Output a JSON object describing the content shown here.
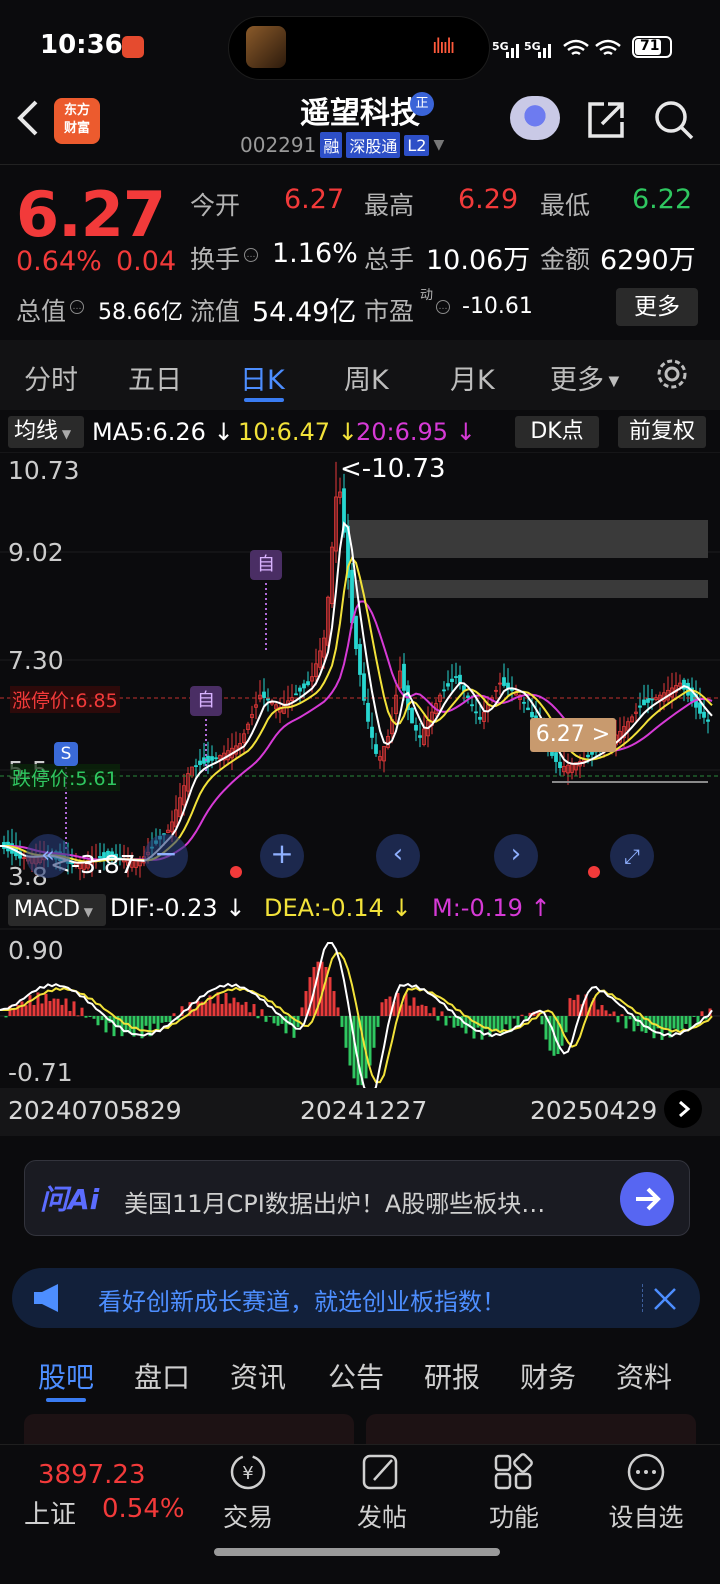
{
  "status": {
    "time": "10:36",
    "battery": "71",
    "net1": "5G",
    "net2": "5G"
  },
  "header": {
    "logo": "东方\n财富",
    "logo_l1": "东方",
    "logo_l2": "财富",
    "name": "遥望科技",
    "badge": "正",
    "code": "002291",
    "tags": [
      "融",
      "深股通",
      "L2"
    ]
  },
  "quote": {
    "price": "6.27",
    "change_pct": "0.64%",
    "change": "0.04",
    "open_label": "今开",
    "open": "6.27",
    "high_label": "最高",
    "high": "6.29",
    "low_label": "最低",
    "low": "6.22",
    "turnover_label": "换手",
    "turnover": "1.16%",
    "volume_label": "总手",
    "volume": "10.06万",
    "amount_label": "金额",
    "amount": "6290万",
    "mcap_label": "总值",
    "mcap": "58.66亿",
    "float_label": "流值",
    "float": "54.49亿",
    "pe_label": "市盈",
    "pe_sup": "动",
    "pe": "-10.61",
    "more": "更多"
  },
  "period_tabs": [
    "分时",
    "五日",
    "日K",
    "周K",
    "月K",
    "更多"
  ],
  "active_period": "日K",
  "ma": {
    "selector": "均线",
    "ma5": "MA5:6.26",
    "ma10": "10:6.47",
    "ma20": "20:6.95",
    "arrow": "↓",
    "dk": "DK点",
    "adjust": "前复权"
  },
  "kline": {
    "y_labels": [
      "10.73",
      "9.02",
      "7.30",
      "5.5",
      "3.8"
    ],
    "max_marker": "<-10.73",
    "min_marker": "<-3.87",
    "limit_up": "涨停价:6.85",
    "limit_down": "跌停价:5.61",
    "current_tag": "6.27 >",
    "marker_self": "自",
    "marker_s": "S"
  },
  "macd": {
    "selector": "MACD",
    "dif": "DIF:-0.23",
    "dea": "DEA:-0.14",
    "m": "M:-0.19",
    "down": "↓",
    "up": "↑",
    "y_top": "0.90",
    "y_bottom": "-0.71"
  },
  "dates": [
    "20240705",
    "829",
    "20241227",
    "20250429"
  ],
  "ai": {
    "logo": "问Ai",
    "text": "美国11月CPI数据出炉！A股哪些板块…"
  },
  "banner": {
    "text": "看好创新成长赛道，就选创业板指数！"
  },
  "bottom_tabs": [
    "股吧",
    "盘口",
    "资讯",
    "公告",
    "研报",
    "财务",
    "资料"
  ],
  "nav": {
    "index_value": "3897.23",
    "index_name": "上证",
    "index_change": "0.54%",
    "items": [
      "交易",
      "发帖",
      "功能",
      "设自选"
    ]
  },
  "colors": {
    "up": "#f23a3a",
    "down": "#2fc760",
    "accent": "#4d8eff",
    "ma5": "#ffffff",
    "ma10": "#f2e23a",
    "ma20": "#d63ad6"
  }
}
